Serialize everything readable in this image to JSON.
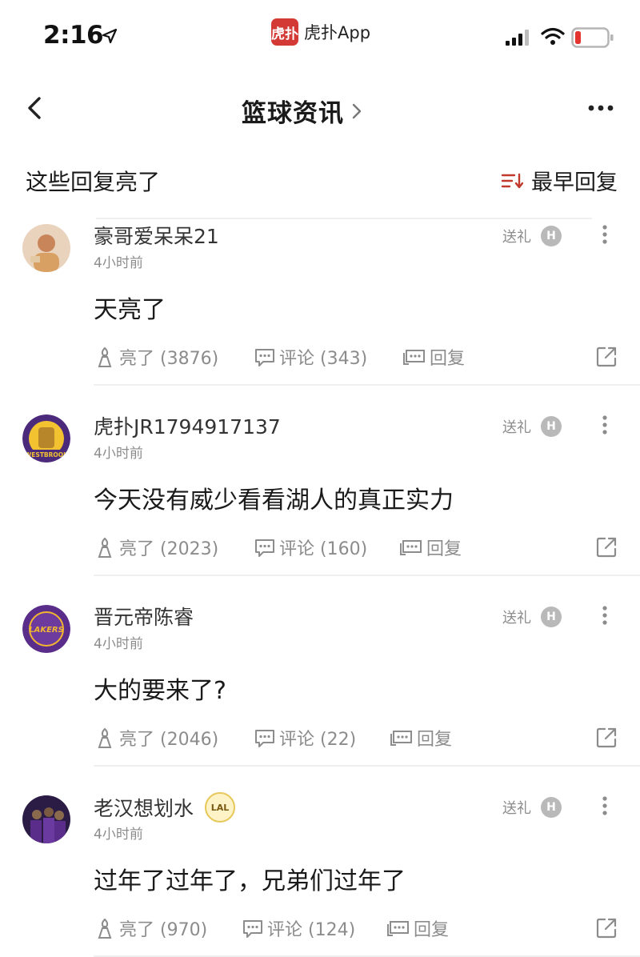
{
  "status_bar": {
    "time": "2:16",
    "app_logo_text": "虎扑",
    "app_name": "虎扑App"
  },
  "nav": {
    "title": "篮球资讯"
  },
  "section": {
    "title": "这些回复亮了",
    "sort_label": "最早回复"
  },
  "comments": [
    {
      "username": "豪哥爱呆呆21",
      "time": "4小时前",
      "text": "天亮了",
      "gift_label": "送礼",
      "like_label": "亮了 (3876)",
      "comment_label": "评论 (343)",
      "reply_label": "回复",
      "avatar_color": "#c9855a"
    },
    {
      "username": "虎扑JR1794917137",
      "time": "4小时前",
      "text": "今天没有威少看看湖人的真正实力",
      "gift_label": "送礼",
      "like_label": "亮了 (2023)",
      "comment_label": "评论 (160)",
      "reply_label": "回复",
      "avatar_text": "WESTBROOK",
      "avatar_color": "#4b2a7c"
    },
    {
      "username": "晋元帝陈睿",
      "time": "4小时前",
      "text": "大的要来了?",
      "gift_label": "送礼",
      "like_label": "亮了 (2046)",
      "comment_label": "评论 (22)",
      "reply_label": "回复",
      "avatar_text": "LAKERS",
      "avatar_color": "#5b2d8a"
    },
    {
      "username": "老汉想划水",
      "badge": "LAL",
      "time": "4小时前",
      "text": "过年了过年了，兄弟们过年了",
      "gift_label": "送礼",
      "like_label": "亮了 (970)",
      "comment_label": "评论 (124)",
      "reply_label": "回复",
      "avatar_color": "#3a2460"
    }
  ],
  "coin_glyph": "H",
  "colors": {
    "accent": "#d43a35",
    "text_primary": "#1a1a1a",
    "text_secondary": "#8c8c8c"
  }
}
